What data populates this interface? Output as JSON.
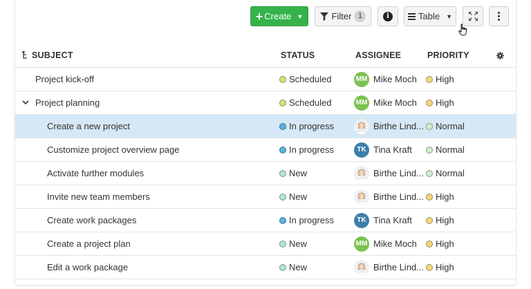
{
  "toolbar": {
    "create_label": "Create",
    "filter_label": "Filter",
    "filter_count": "1",
    "view_label": "Table"
  },
  "columns": {
    "subject": "SUBJECT",
    "status": "STATUS",
    "assignee": "ASSIGNEE",
    "priority": "PRIORITY"
  },
  "rows": [
    {
      "subject": "Project kick-off",
      "status": "Scheduled",
      "assignee": "Mike Moch",
      "initials": "MM",
      "priority": "High"
    },
    {
      "subject": "Project planning",
      "status": "Scheduled",
      "assignee": "Mike Moch",
      "initials": "MM",
      "priority": "High"
    },
    {
      "subject": "Create a new project",
      "status": "In progress",
      "assignee": "Birthe Lind...",
      "initials": "",
      "priority": "Normal"
    },
    {
      "subject": "Customize project overview page",
      "status": "In progress",
      "assignee": "Tina Kraft",
      "initials": "TK",
      "priority": "Normal"
    },
    {
      "subject": "Activate further modules",
      "status": "New",
      "assignee": "Birthe Lind...",
      "initials": "",
      "priority": "Normal"
    },
    {
      "subject": "Invite new team members",
      "status": "New",
      "assignee": "Birthe Lind...",
      "initials": "",
      "priority": "High"
    },
    {
      "subject": "Create work packages",
      "status": "In progress",
      "assignee": "Tina Kraft",
      "initials": "TK",
      "priority": "High"
    },
    {
      "subject": "Create a project plan",
      "status": "New",
      "assignee": "Mike Moch",
      "initials": "MM",
      "priority": "High"
    },
    {
      "subject": "Edit a work package",
      "status": "New",
      "assignee": "Birthe Lind...",
      "initials": "",
      "priority": "High"
    }
  ],
  "colors": {
    "create_button": "#35b24a",
    "selected_row": "#d6e8f6",
    "status_scheduled": "#d8e07a",
    "status_in_progress": "#5ab2e0",
    "status_new": "#b3e5cf",
    "priority_high": "#f5d580",
    "priority_normal": "#cfeed0",
    "avatar_mm": "#7cc152",
    "avatar_tk": "#3d7fa8"
  },
  "icons": {
    "create": "plus-icon",
    "filter": "funnel-icon",
    "info": "info-icon",
    "view": "table-view-icon",
    "fullscreen": "expand-icon",
    "more": "kebab-menu-icon",
    "hierarchy": "hierarchy-icon",
    "settings": "gear-icon",
    "collapse": "chevron-down-icon"
  }
}
